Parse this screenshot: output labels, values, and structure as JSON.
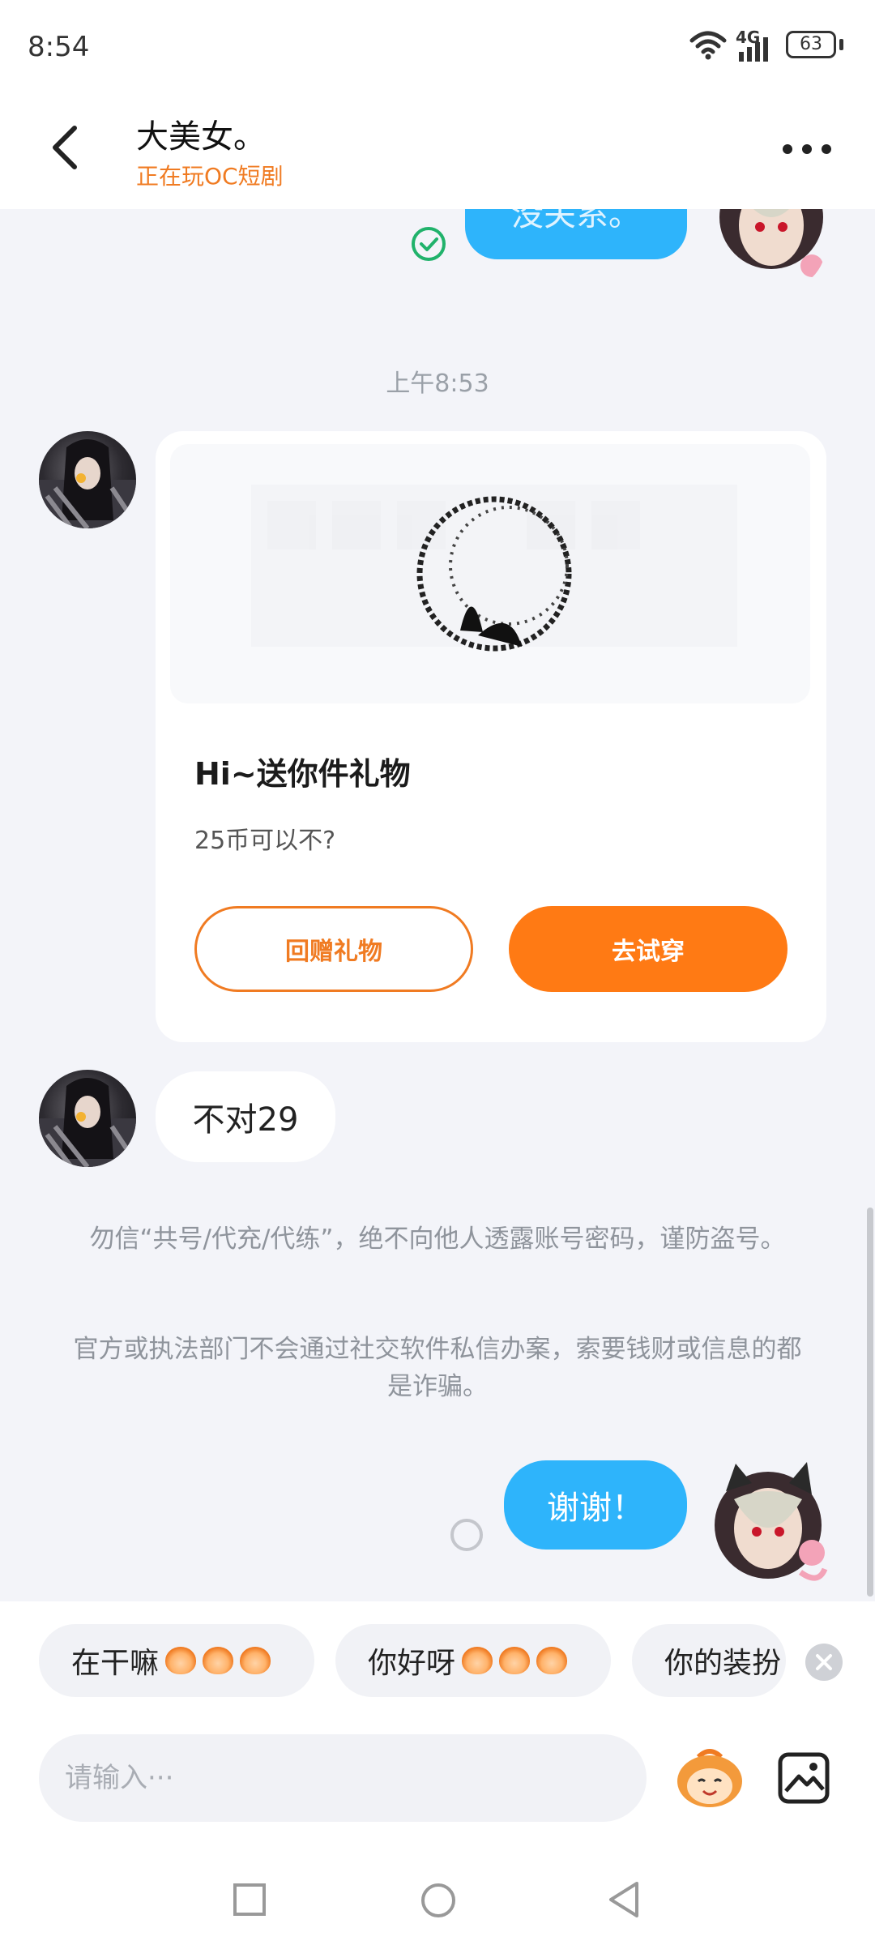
{
  "status_bar": {
    "time": "8:54",
    "network": "4G",
    "battery": "63"
  },
  "header": {
    "name": "大美女。",
    "status": "正在玩OC短剧"
  },
  "messages": {
    "sent_top_partial": "没关系。",
    "timestamp": "上午8:53",
    "gift_card": {
      "title": "Hi~送你件礼物",
      "subtitle": "25币可以不?",
      "return_button": "回赠礼物",
      "try_button": "去试穿"
    },
    "received_text": "不对29",
    "notice_1": "勿信“共号/代充/代练”，绝不向他人透露账号密码，谨防盗号。",
    "notice_2": "官方或执法部门不会通过社交软件私信办案，索要钱财或信息的都是诈骗。",
    "sent_last": "谢谢！"
  },
  "quick_replies": [
    {
      "label": "在干嘛"
    },
    {
      "label": "你好呀"
    },
    {
      "label": "你的装扮"
    }
  ],
  "composer": {
    "placeholder": "请输入···"
  },
  "colors": {
    "accent_orange": "#ff7a14",
    "bubble_blue": "#2eb4fb",
    "background": "#f3f4f9"
  },
  "icons": {
    "back": "back-arrow-icon",
    "more": "more-dots-icon",
    "read": "check-circle-icon",
    "sticker": "monkey-sticker-icon",
    "image": "image-icon"
  }
}
